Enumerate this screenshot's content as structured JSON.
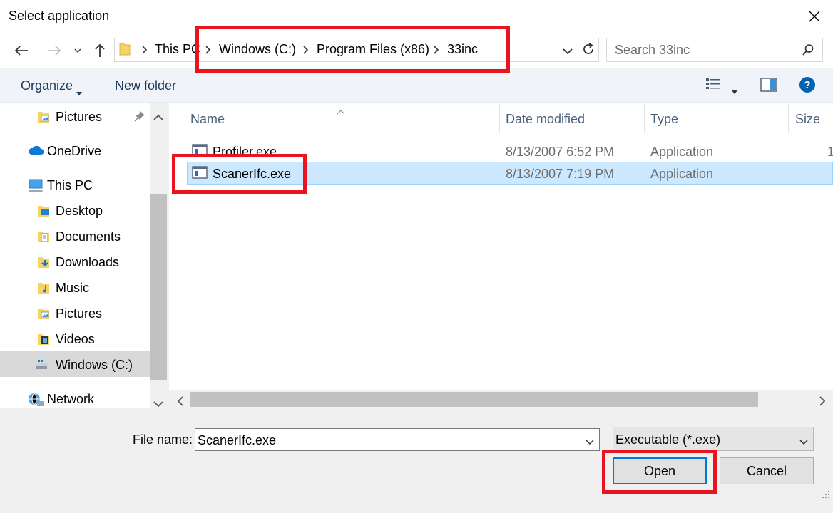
{
  "window": {
    "title": "Select application"
  },
  "address": {
    "breadcrumbs": [
      "This PC",
      "Windows (C:)",
      "Program Files (x86)",
      "33inc"
    ]
  },
  "search": {
    "placeholder": "Search 33inc"
  },
  "commandbar": {
    "organize": "Organize",
    "new_folder": "New folder"
  },
  "nav": {
    "items": [
      {
        "label": "Pictures",
        "icon": "pictures-folder-icon"
      },
      {
        "label": "OneDrive",
        "icon": "onedrive-cloud-icon"
      },
      {
        "label": "This PC",
        "icon": "computer-icon"
      },
      {
        "label": "Desktop",
        "icon": "desktop-folder-icon"
      },
      {
        "label": "Documents",
        "icon": "documents-folder-icon"
      },
      {
        "label": "Downloads",
        "icon": "downloads-folder-icon"
      },
      {
        "label": "Music",
        "icon": "music-folder-icon"
      },
      {
        "label": "Pictures",
        "icon": "pictures-folder-icon"
      },
      {
        "label": "Videos",
        "icon": "videos-folder-icon"
      },
      {
        "label": "Windows (C:)",
        "icon": "drive-icon"
      },
      {
        "label": "Network",
        "icon": "network-icon"
      }
    ],
    "selected": "Windows (C:)"
  },
  "files": {
    "columns": [
      "Name",
      "Date modified",
      "Type",
      "Size"
    ],
    "rows": [
      {
        "name": "Profiler.exe",
        "date": "8/13/2007 6:52 PM",
        "type": "Application",
        "size": "1"
      },
      {
        "name": "ScanerIfc.exe",
        "date": "8/13/2007 7:19 PM",
        "type": "Application",
        "size": ""
      }
    ],
    "selected": "ScanerIfc.exe"
  },
  "footer": {
    "file_name_label": "File name:",
    "file_name_value": "ScanerIfc.exe",
    "filter": "Executable (*.exe)",
    "open": "Open",
    "cancel": "Cancel"
  },
  "colors": {
    "highlight_red": "#e8141e",
    "selection": "#cce8ff",
    "accent": "#0078d7"
  }
}
